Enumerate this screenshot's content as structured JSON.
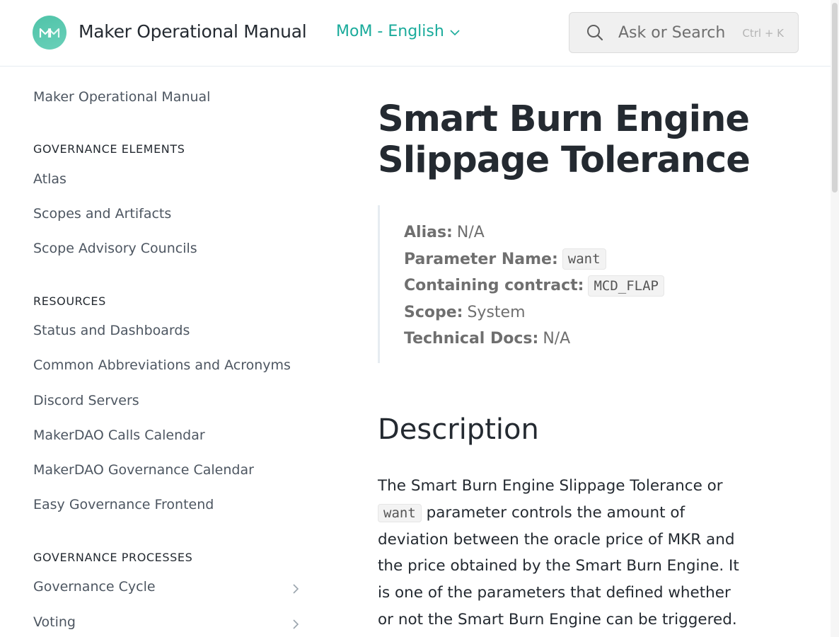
{
  "header": {
    "site_title": "Maker Operational Manual",
    "language": "MoM - English",
    "search_placeholder": "Ask or Search",
    "search_shortcut": "Ctrl + K"
  },
  "sidebar": {
    "top_link": "Maker Operational Manual",
    "sections": [
      {
        "title": "GOVERNANCE ELEMENTS",
        "items": [
          "Atlas",
          "Scopes and Artifacts",
          "Scope Advisory Councils"
        ]
      },
      {
        "title": "RESOURCES",
        "items": [
          "Status and Dashboards",
          "Common Abbreviations and Acronyms",
          "Discord Servers",
          "MakerDAO Calls Calendar",
          "MakerDAO Governance Calendar",
          "Easy Governance Frontend"
        ]
      },
      {
        "title": "GOVERNANCE PROCESSES",
        "items": [
          "Governance Cycle",
          "Voting"
        ]
      }
    ]
  },
  "main": {
    "title": "Smart Burn Engine Slippage Tolerance",
    "meta": {
      "alias_label": "Alias:",
      "alias_value": "N/A",
      "param_label": "Parameter Name:",
      "param_value": "want",
      "contract_label": "Containing contract:",
      "contract_value": "MCD_FLAP",
      "scope_label": "Scope:",
      "scope_value": "System",
      "docs_label": "Technical Docs:",
      "docs_value": "N/A"
    },
    "description_heading": "Description",
    "description_intro": "The Smart Burn Engine Slippage Tolerance or",
    "description_code": "want",
    "description_rest": " parameter controls the amount of deviation between the oracle price of MKR and the price obtained by the Smart Burn Engine. It is one of the parameters that defined whether or not the Smart Burn Engine can be triggered."
  },
  "colors": {
    "accent": "#1aab9b",
    "logo": "#4fc3a8",
    "text": "#242a31",
    "muted": "#6f6f6f"
  }
}
